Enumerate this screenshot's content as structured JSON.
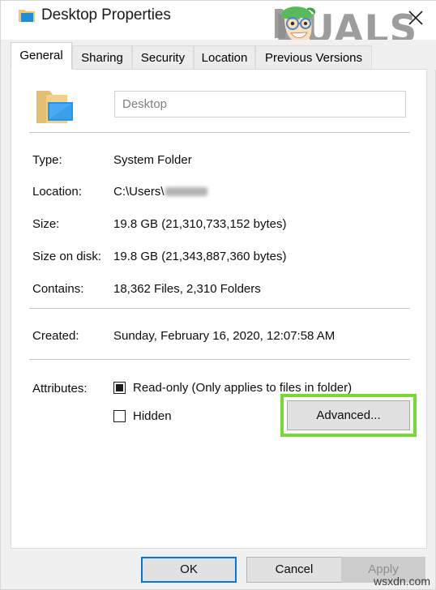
{
  "window": {
    "title": "Desktop Properties",
    "icon": "folder-desktop-icon",
    "close_label": "×"
  },
  "watermark": {
    "brand": "APPUALS",
    "brand_visible_text": "PUALS",
    "bottom": "wsxdn.com"
  },
  "tabs": [
    {
      "label": "General",
      "active": true
    },
    {
      "label": "Sharing",
      "active": false
    },
    {
      "label": "Security",
      "active": false
    },
    {
      "label": "Location",
      "active": false
    },
    {
      "label": "Previous Versions",
      "active": false
    }
  ],
  "general": {
    "name_value": "Desktop",
    "name_placeholder": "Desktop",
    "properties": [
      {
        "label": "Type:",
        "value": "System Folder",
        "redacted": false
      },
      {
        "label": "Location:",
        "value": "C:\\Users\\",
        "redacted": true
      },
      {
        "label": "Size:",
        "value": "19.8 GB (21,310,733,152 bytes)",
        "redacted": false
      },
      {
        "label": "Size on disk:",
        "value": "19.8 GB (21,343,887,360 bytes)",
        "redacted": false
      },
      {
        "label": "Contains:",
        "value": "18,362 Files, 2,310 Folders",
        "redacted": false
      },
      {
        "label": "Created:",
        "value": "Sunday, February 16, 2020, 12:07:58 AM",
        "redacted": false
      }
    ],
    "attributes_label": "Attributes:",
    "attributes": [
      {
        "label": "Read-only (Only applies to files in folder)",
        "state": "filled"
      },
      {
        "label": "Hidden",
        "state": "unchecked"
      }
    ],
    "advanced_button": "Advanced..."
  },
  "footer": {
    "ok": "OK",
    "cancel": "Cancel",
    "apply": "Apply"
  },
  "colors": {
    "highlight": "#76d935",
    "focus_border": "#0078d7",
    "dialog_bg": "#f0f0f0",
    "panel_bg": "#ffffff",
    "disabled_text": "#8f8f8f"
  }
}
